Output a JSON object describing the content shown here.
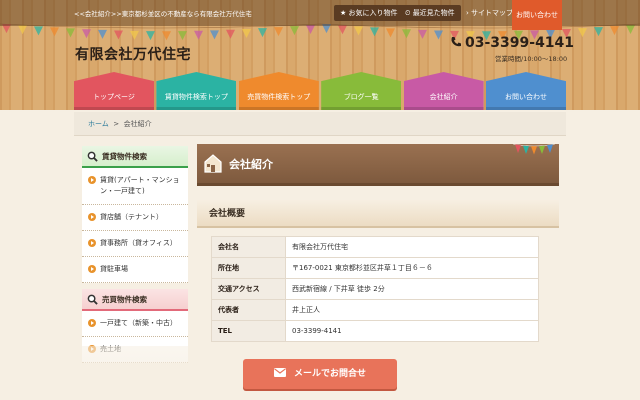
{
  "topbar": {
    "breadcrumb_text": "<<会社紹介>>東京都杉並区の不動産なら有限会社万代住宅",
    "favorites_label": "お気に入り物件",
    "recent_label": "最近見た物件",
    "sitemap_label": "サイトマップ",
    "contact_label": "お問い合わせ"
  },
  "header": {
    "company_name": "有限会社万代住宅",
    "phone": "03-3399-4141",
    "hours": "営業時間/10:00～18:00"
  },
  "nav": {
    "items": [
      {
        "label": "トップページ",
        "color": "#e2555f"
      },
      {
        "label": "賃貸物件検索トップ",
        "color": "#2bb3a3"
      },
      {
        "label": "売買物件検索トップ",
        "color": "#ef8a2d"
      },
      {
        "label": "ブログ一覧",
        "color": "#88bb3a"
      },
      {
        "label": "会社紹介",
        "color": "#c85aa5"
      },
      {
        "label": "お問い合わせ",
        "color": "#4f8fcf"
      }
    ]
  },
  "crumbs": {
    "home": "ホーム",
    "sep": ">",
    "current": "会社紹介"
  },
  "sidebar": {
    "rent_heading": "賃貸物件検索",
    "rent_items": [
      "賃貸(アパート・マンション・一戸建て)",
      "貸店舗（テナント）",
      "貸事務所（貸オフィス）",
      "貸駐車場"
    ],
    "sale_heading": "売買物件検索",
    "sale_items": [
      "一戸建て（新築・中古）",
      "売土地"
    ]
  },
  "main": {
    "title": "会社紹介",
    "section_title": "会社概要",
    "rows": [
      {
        "key": "会社名",
        "value": "有限会社万代住宅"
      },
      {
        "key": "所在地",
        "value": "〒167-0021 東京都杉並区井草１丁目６－６"
      },
      {
        "key": "交通アクセス",
        "value": "西武新宿線 / 下井草 徒歩 2分"
      },
      {
        "key": "代表者",
        "value": "井上正人"
      },
      {
        "key": "TEL",
        "value": "03-3399-4141"
      }
    ]
  },
  "mail_button": {
    "label": "メールでお問合せ"
  },
  "colors": {
    "accent": "#e05a2b",
    "mail_button": "#e8735a",
    "title_brown": "#8a6446"
  }
}
